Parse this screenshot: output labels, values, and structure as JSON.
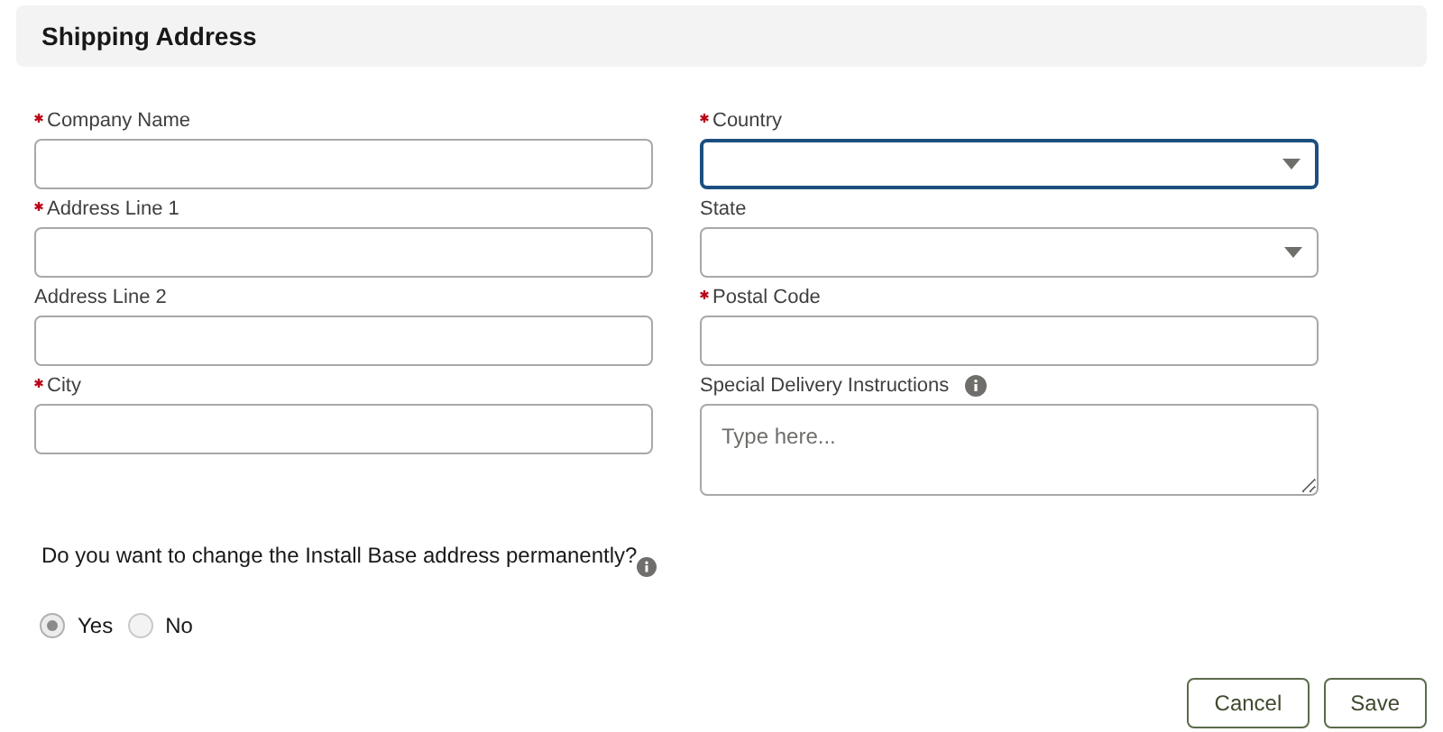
{
  "header": {
    "title": "Shipping Address"
  },
  "columns": [
    {
      "fields": [
        {
          "label": "Company Name",
          "kind": "text",
          "required": true,
          "focused": false
        },
        {
          "label": "Address Line 1",
          "kind": "text",
          "required": true,
          "focused": false
        },
        {
          "label": "Address Line 2",
          "kind": "text",
          "required": false,
          "focused": false
        },
        {
          "label": "City",
          "kind": "text",
          "required": true,
          "focused": false
        }
      ]
    },
    {
      "fields": [
        {
          "label": "Country",
          "kind": "select",
          "required": true,
          "focused": true
        },
        {
          "label": "State",
          "kind": "select",
          "required": false,
          "focused": false
        },
        {
          "label": "Postal Code",
          "kind": "text",
          "required": true,
          "focused": false
        },
        {
          "label": "Special Delivery Instructions",
          "kind": "textarea",
          "required": false,
          "focused": false,
          "info": true,
          "placeholder": "Type here..."
        }
      ]
    }
  ],
  "question": {
    "text": "Do you want to change the Install Base address permanently?",
    "info": true,
    "options": [
      {
        "label": "Yes",
        "selected": true
      },
      {
        "label": "No",
        "selected": false
      }
    ]
  },
  "buttons": [
    {
      "label": "Cancel"
    },
    {
      "label": "Save"
    }
  ]
}
